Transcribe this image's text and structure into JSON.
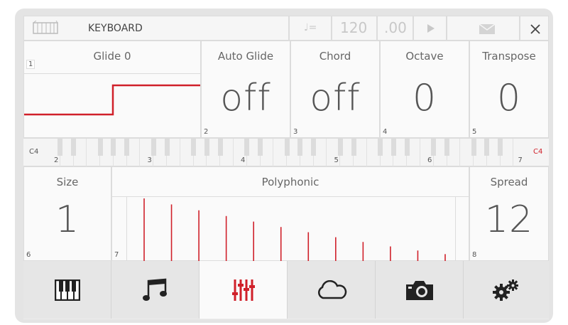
{
  "header": {
    "title": "KEYBOARD",
    "tempo_symbol": "♩=",
    "tempo": "120",
    "tempo_fraction": ".00"
  },
  "params": {
    "glide": {
      "label": "Glide 0",
      "num": "1"
    },
    "auto_glide": {
      "label": "Auto Glide",
      "value": "off",
      "num": "2"
    },
    "chord": {
      "label": "Chord",
      "value": "off",
      "num": "3"
    },
    "octave": {
      "label": "Octave",
      "value": "0",
      "num": "4"
    },
    "transpose": {
      "label": "Transpose",
      "value": "0",
      "num": "5"
    }
  },
  "keyboard": {
    "low_note": "C4",
    "high_note": "C4",
    "octaves": [
      "2",
      "3",
      "4",
      "5",
      "6",
      "7"
    ]
  },
  "voice": {
    "size": {
      "label": "Size",
      "value": "1",
      "num": "6"
    },
    "polyphonic": {
      "label": "Polyphonic",
      "num": "7"
    },
    "spread": {
      "label": "Spread",
      "value": "12",
      "num": "8"
    }
  },
  "tabs": [
    {
      "icon": "piano-icon",
      "active": false
    },
    {
      "icon": "music-notes-icon",
      "active": false
    },
    {
      "icon": "sliders-icon",
      "active": true
    },
    {
      "icon": "cloud-icon",
      "active": false
    },
    {
      "icon": "camera-icon",
      "active": false
    },
    {
      "icon": "gears-icon",
      "active": false
    }
  ],
  "colors": {
    "accent": "#d0202a",
    "background": "#ececec",
    "text": "#555555"
  }
}
